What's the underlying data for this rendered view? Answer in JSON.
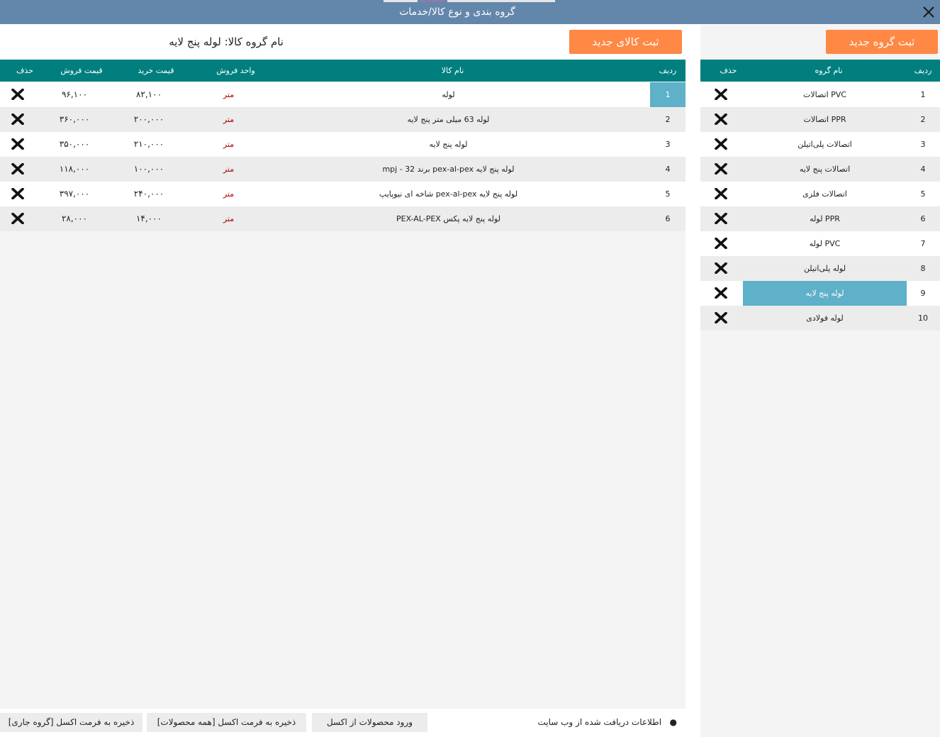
{
  "window": {
    "title": "گروه بندی و نوع کالا/خدمات"
  },
  "groups_panel": {
    "new_group_button": "ثبت گروه جدید",
    "columns": {
      "row": "ردیف",
      "name": "نام گروه",
      "delete": "حذف"
    },
    "selected_index": 8,
    "rows": [
      {
        "n": "1",
        "name": "اتصالات PVC"
      },
      {
        "n": "2",
        "name": "اتصالات PPR"
      },
      {
        "n": "3",
        "name": "اتصالات پلی‌اتیلن"
      },
      {
        "n": "4",
        "name": "اتصالات پنج لایه"
      },
      {
        "n": "5",
        "name": "اتصالات فلزی"
      },
      {
        "n": "6",
        "name": "لوله PPR"
      },
      {
        "n": "7",
        "name": "لوله PVC"
      },
      {
        "n": "8",
        "name": "لوله پلی‌اتیلن"
      },
      {
        "n": "9",
        "name": "لوله پنج لایه"
      },
      {
        "n": "10",
        "name": "لوله فولادی"
      }
    ]
  },
  "products_panel": {
    "new_product_button": "ثبت کالای جدید",
    "group_name_label": "نام گروه کالا: لوله پنج لایه",
    "columns": {
      "row": "ردیف",
      "name": "نام کالا",
      "unit": "واحد فروش",
      "buy": "قیمت خرید",
      "sell": "قیمت فروش",
      "delete": "حذف"
    },
    "rows": [
      {
        "n": "1",
        "name": "لوله",
        "unit": "متر",
        "buy": "۸۲,۱۰۰",
        "sell": "۹۶,۱۰۰"
      },
      {
        "n": "2",
        "name": "لوله 63 میلی متر پنج لایه",
        "unit": "متر",
        "buy": "۲۰۰,۰۰۰",
        "sell": "۳۶۰,۰۰۰"
      },
      {
        "n": "3",
        "name": "لوله پنج لایه",
        "unit": "متر",
        "buy": "۲۱۰,۰۰۰",
        "sell": "۳۵۰,۰۰۰"
      },
      {
        "n": "4",
        "name": "لوله پنج لایه pex-al-pex برند 32 - mpj",
        "unit": "متر",
        "buy": "۱۰۰,۰۰۰",
        "sell": "۱۱۸,۰۰۰"
      },
      {
        "n": "5",
        "name": "لوله پنج لایه pex-al-pex شاخه ای نیوپایپ",
        "unit": "متر",
        "buy": "۲۴۰,۰۰۰",
        "sell": "۳۹۷,۰۰۰"
      },
      {
        "n": "6",
        "name": "لوله پنج لایه پکس PEX-AL-PEX",
        "unit": "متر",
        "buy": "۱۴,۰۰۰",
        "sell": "۲۸,۰۰۰"
      }
    ]
  },
  "footer": {
    "status_text": "اطلاعات دریافت شده از وب سایت",
    "import_excel": "ورود محصولات از اکسل",
    "export_all": "ذخیره به فرمت اکسل [همه محصولات]",
    "export_group": "ذخیره به فرمت اکسل [گروه جاری]"
  },
  "colors": {
    "titlebar": "#6387ab",
    "table_header": "#017f7f",
    "button_orange": "#ff8844",
    "selection": "#5fb0c9",
    "unit_text": "#b00000"
  }
}
